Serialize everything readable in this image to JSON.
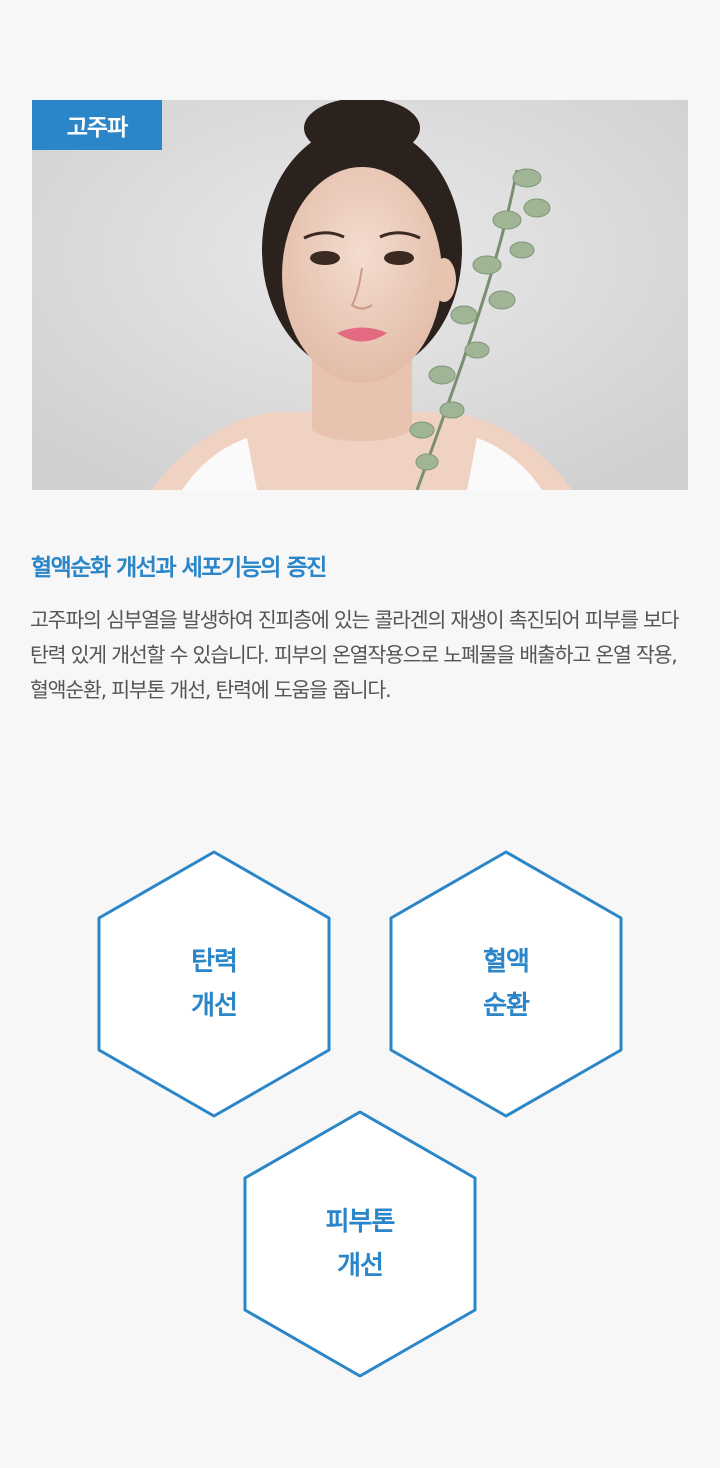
{
  "badge": "고주파",
  "hero_image": {
    "alt": ""
  },
  "headline": "혈액순화 개선과 세포기능의 증진",
  "description": "고주파의 심부열을 발생하여 진피층에 있는 콜라겐의 재생이 촉진되어 피부를 보다 탄력 있게 개선할 수 있습니다.  피부의 온열작용으로  노폐물을 배출하고 온열 작용, 혈액순환,  피부톤 개선, 탄력에 도움을 줍니다.",
  "benefits": [
    {
      "line1": "탄력",
      "line2": "개선"
    },
    {
      "line1": "혈액",
      "line2": "순환"
    },
    {
      "line1": "피부톤",
      "line2": "개선"
    }
  ],
  "colors": {
    "accent": "#2a86c8",
    "background": "#f7f7f7",
    "body_text": "#555555"
  }
}
